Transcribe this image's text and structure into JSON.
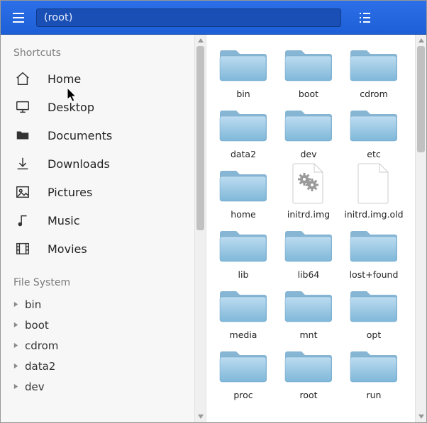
{
  "colors": {
    "accent": "#2c6fe8",
    "folderA": "#bcdcf0",
    "folderB": "#7fb7d9"
  },
  "titlebar": {
    "path": "(root)",
    "menu_icon": "menu-icon",
    "view_icon": "list-view-icon"
  },
  "sidebar": {
    "shortcuts_header": "Shortcuts",
    "shortcuts": [
      {
        "id": "home",
        "label": "Home",
        "icon": "home"
      },
      {
        "id": "desktop",
        "label": "Desktop",
        "icon": "desktop"
      },
      {
        "id": "documents",
        "label": "Documents",
        "icon": "folder"
      },
      {
        "id": "downloads",
        "label": "Downloads",
        "icon": "download"
      },
      {
        "id": "pictures",
        "label": "Pictures",
        "icon": "image"
      },
      {
        "id": "music",
        "label": "Music",
        "icon": "music"
      },
      {
        "id": "movies",
        "label": "Movies",
        "icon": "film"
      }
    ],
    "filesystem_header": "File System",
    "filesystem": [
      {
        "label": "bin"
      },
      {
        "label": "boot"
      },
      {
        "label": "cdrom"
      },
      {
        "label": "data2"
      },
      {
        "label": "dev"
      }
    ]
  },
  "files": [
    {
      "name": "bin",
      "type": "folder"
    },
    {
      "name": "boot",
      "type": "folder"
    },
    {
      "name": "cdrom",
      "type": "folder"
    },
    {
      "name": "data2",
      "type": "folder"
    },
    {
      "name": "dev",
      "type": "folder"
    },
    {
      "name": "etc",
      "type": "folder"
    },
    {
      "name": "home",
      "type": "folder"
    },
    {
      "name": "initrd.img",
      "type": "file-gears"
    },
    {
      "name": "initrd.img.old",
      "type": "file-blank"
    },
    {
      "name": "lib",
      "type": "folder"
    },
    {
      "name": "lib64",
      "type": "folder"
    },
    {
      "name": "lost+found",
      "type": "folder"
    },
    {
      "name": "media",
      "type": "folder"
    },
    {
      "name": "mnt",
      "type": "folder"
    },
    {
      "name": "opt",
      "type": "folder"
    },
    {
      "name": "proc",
      "type": "folder"
    },
    {
      "name": "root",
      "type": "folder"
    },
    {
      "name": "run",
      "type": "folder"
    }
  ]
}
